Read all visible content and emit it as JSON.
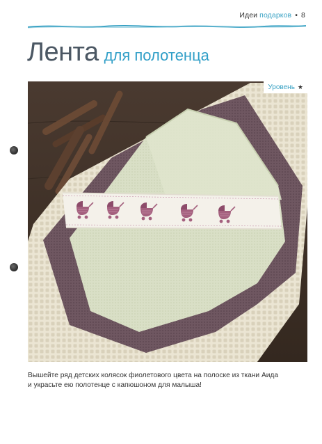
{
  "header": {
    "section": "Идеи",
    "subsection": "подарков",
    "separator": "•",
    "page_number": "8"
  },
  "title": {
    "main": "Лента",
    "rest": "для полотенца"
  },
  "photo": {
    "level_label": "Уровень",
    "level_stars": "★",
    "colors": {
      "table": "#3d2f27",
      "waffle_towel": "#ece6d6",
      "purple_towel": "#6e5660",
      "green_towel": "#d8dfc4",
      "aida_band": "#f4f1ea",
      "pram_motif": "#a4607e"
    }
  },
  "caption": {
    "line1": "Вышейте ряд детских колясок фиолетового цвета на полоске из ткани Аида",
    "line2": "и украсьте ею полотенце с капюшоном для малыша!"
  }
}
